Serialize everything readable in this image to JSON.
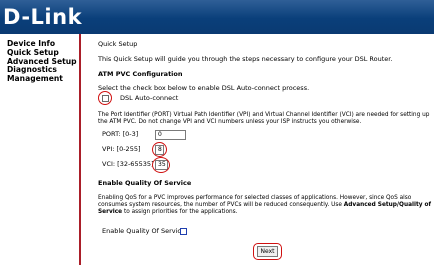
{
  "header": {
    "brand": "D-Link"
  },
  "sidebar": {
    "items": [
      "Device Info",
      "Quick Setup",
      "Advanced Setup",
      "Diagnostics",
      "Management"
    ]
  },
  "main": {
    "title": "Quick Setup",
    "intro": "This Quick Setup will guide you through the steps necessary to configure your DSL Router.",
    "atm": {
      "heading": "ATM PVC Configuration",
      "instruction": "Select the check box below to enable DSL Auto-connect process.",
      "auto_connect_label": "DSL Auto-connect",
      "description": "The Port Identifier (PORT) Virtual Path Identifier (VPI) and Virtual Channel Identifier (VCI) are needed for setting up the ATM PVC. Do not change VPI and VCI numbers unless your ISP instructs you otherwise.",
      "port_label": "PORT: [0-3]",
      "port_value": "0",
      "vpi_label": "VPI: [0-255]",
      "vpi_value": "8",
      "vci_label": "VCI: [32-65535]",
      "vci_value": "35"
    },
    "qos": {
      "heading": "Enable Quality Of Service",
      "desc_part1": "Enabling QoS for a PVC improves performance for selected classes of applications. However, since QoS also consumes system resources, the number of PVCs will be reduced consequently. Use ",
      "desc_bold": "Advanced Setup/Quality of Service",
      "desc_part2": " to assign priorities for the applications.",
      "enable_label": "Enable Quality Of Service"
    },
    "next_label": "Next"
  },
  "colors": {
    "header_bg": "#0a3f7a",
    "sidebar_border": "#aa1e29",
    "highlight": "#d01010"
  }
}
